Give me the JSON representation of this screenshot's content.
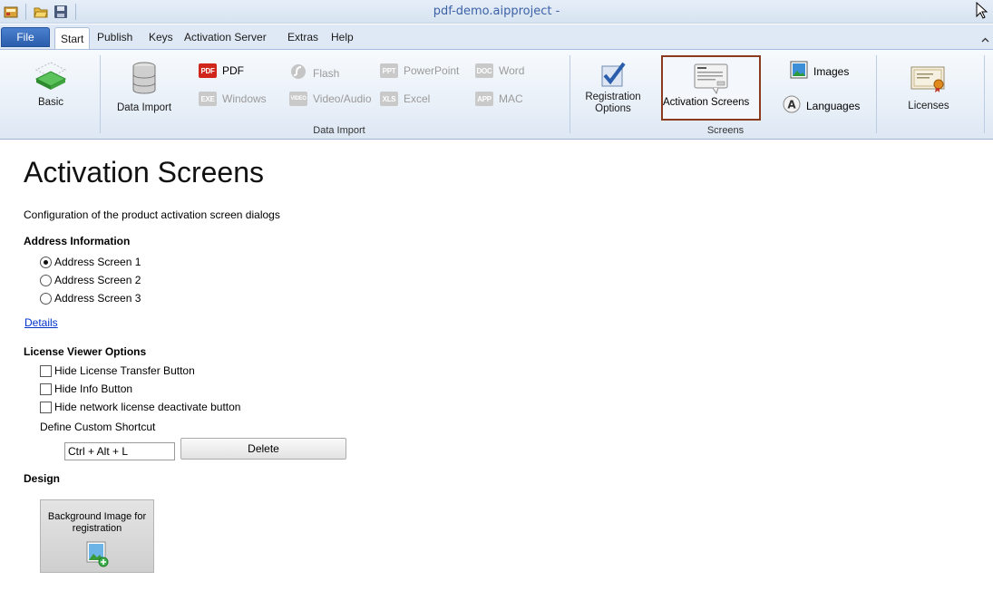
{
  "window": {
    "title": "pdf-demo.aipproject -"
  },
  "menu": {
    "file": "File",
    "tabs": [
      "Start",
      "Publish",
      "Keys",
      "Activation Server",
      "Extras",
      "Help"
    ]
  },
  "ribbon": {
    "basic": "Basic",
    "data_import": {
      "big_label": "Data Import",
      "group_label": "Data Import",
      "items": [
        {
          "icon_text": "PDF",
          "label": "PDF",
          "enabled": true
        },
        {
          "icon_text": "EXE",
          "label": "Windows",
          "enabled": false
        },
        {
          "icon_text": "",
          "label": "Flash",
          "enabled": false
        },
        {
          "icon_text": "VIDEO",
          "label": "Video/Audio",
          "enabled": false
        },
        {
          "icon_text": "PPT",
          "label": "PowerPoint",
          "enabled": false
        },
        {
          "icon_text": "XLS",
          "label": "Excel",
          "enabled": false
        },
        {
          "icon_text": "DOC",
          "label": "Word",
          "enabled": false
        },
        {
          "icon_text": "APP",
          "label": "MAC",
          "enabled": false
        }
      ]
    },
    "screens": {
      "group_label": "Screens",
      "registration_options": [
        "Registration",
        "Options"
      ],
      "activation_screens": "Activation Screens",
      "images": "Images",
      "languages": "Languages"
    },
    "licenses": "Licenses"
  },
  "content": {
    "title": "Activation Screens",
    "description": "Configuration of the product activation screen dialogs",
    "address": {
      "heading": "Address Information",
      "options": [
        "Address Screen 1",
        "Address Screen 2",
        "Address Screen 3"
      ],
      "selected": 0,
      "details_link": "Details"
    },
    "license_viewer": {
      "heading": "License Viewer Options",
      "checks": [
        {
          "label": "Hide License Transfer Button",
          "checked": false
        },
        {
          "label": "Hide Info Button",
          "checked": false
        },
        {
          "label": "Hide network license deactivate button",
          "checked": false
        }
      ],
      "shortcut_label": "Define Custom Shortcut",
      "shortcut_value": "Ctrl + Alt + L",
      "delete_label": "Delete"
    },
    "design": {
      "heading": "Design",
      "bg_button": [
        "Background Image for",
        "registration"
      ]
    }
  },
  "colors": {
    "selected_border": "#8b3a1e",
    "file_tab": "#2a5ead",
    "link": "#0033cc"
  }
}
